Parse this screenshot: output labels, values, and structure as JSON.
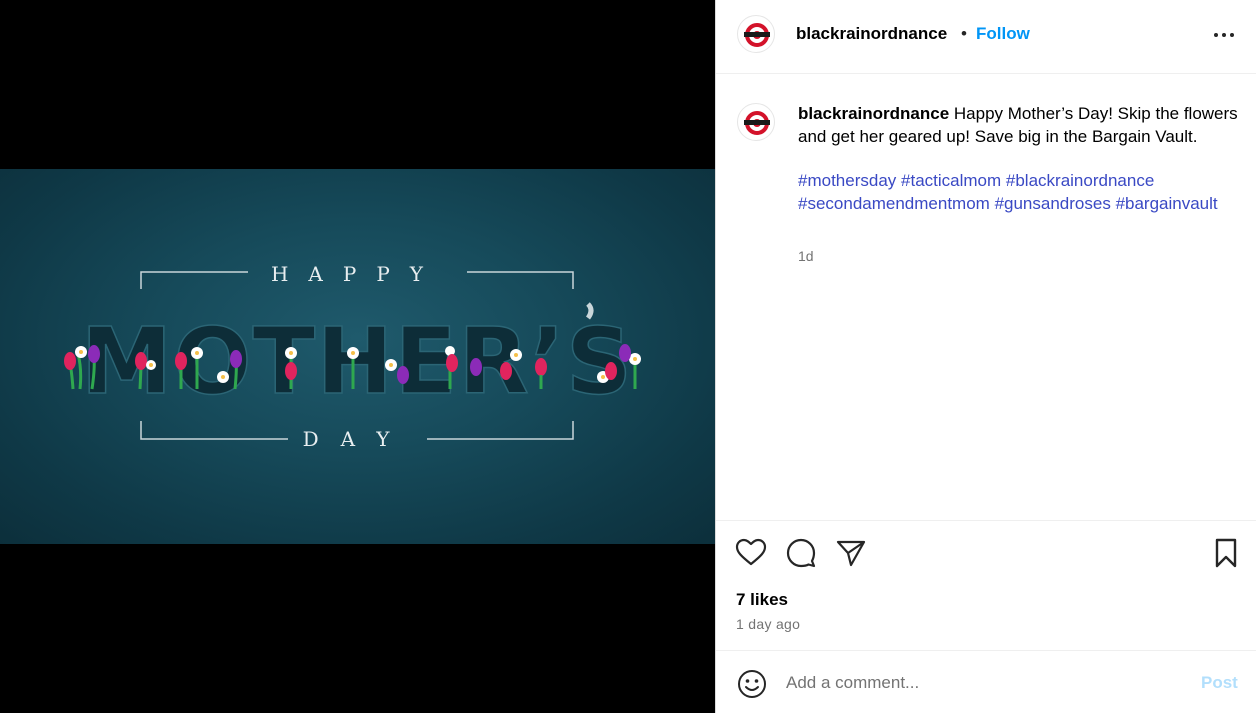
{
  "post": {
    "username": "blackrainordnance",
    "follow_label": "Follow",
    "separator": "•",
    "caption_text": "Happy Mother’s Day! Skip the flowers and get her geared up! Save big in the Bargain Vault.",
    "hashtags": [
      "#mothersday",
      "#tacticalmom",
      "#blackrainordnance",
      "#secondamendmentmom",
      "#gunsandroses",
      "#bargainvault"
    ],
    "caption_time": "1d",
    "likes": "7 likes",
    "posted_ago": "1 day ago"
  },
  "image": {
    "top_word": "HAPPY",
    "main_word": "MOTHER’S",
    "bottom_word": "DAY"
  },
  "comment": {
    "placeholder": "Add a comment...",
    "post_label": "Post"
  },
  "colors": {
    "follow": "#0095f6",
    "hashtag": "#3a49c4",
    "post_disabled": "#b2dffc",
    "banner": "#164a5a"
  },
  "icons": [
    "avatar-logo",
    "more-options-icon",
    "heart-icon",
    "comment-icon",
    "share-icon",
    "bookmark-icon",
    "emoji-icon"
  ]
}
